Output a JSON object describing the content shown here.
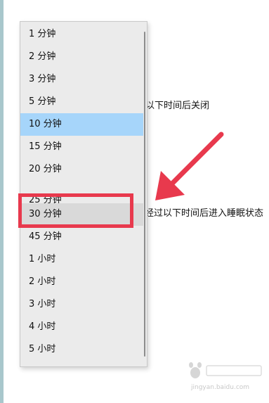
{
  "background": {
    "text_line_1": "以下时间后关闭",
    "text_line_2": "经过以下时间后进入睡眠状态"
  },
  "dropdown": {
    "options": [
      {
        "label": "1 分钟"
      },
      {
        "label": "2 分钟"
      },
      {
        "label": "3 分钟"
      },
      {
        "label": "5 分钟"
      },
      {
        "label": "10 分钟",
        "state": "selected"
      },
      {
        "label": "15 分钟"
      },
      {
        "label": "20 分钟"
      },
      {
        "label": "25 分钟",
        "state": "partially-covered"
      },
      {
        "label": "30 分钟",
        "state": "hover"
      },
      {
        "label": "45 分钟"
      },
      {
        "label": "1 小时"
      },
      {
        "label": "2 小时"
      },
      {
        "label": "3 小时"
      },
      {
        "label": "4 小时"
      },
      {
        "label": "5 小时"
      }
    ]
  },
  "annotation": {
    "color": "#e8394d"
  },
  "colors": {
    "selected": "#a6d5fa",
    "hover": "#d9d9d9",
    "menu_bg": "#ebebeb",
    "left_strip": "#a8c7cc"
  },
  "watermark": {
    "text": "jingyan.baidu.com"
  }
}
